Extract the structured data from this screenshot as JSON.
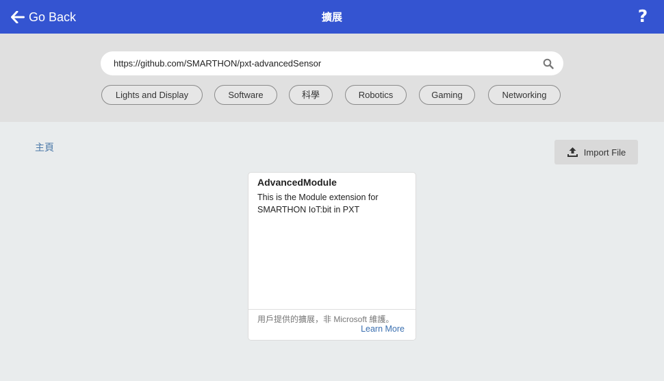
{
  "header": {
    "back_label": "Go Back",
    "title": "擴展",
    "help_label": "?"
  },
  "search": {
    "value": "https://github.com/SMARTHON/pxt-advancedSensor",
    "icon": "search-icon"
  },
  "categories": [
    "Lights and Display",
    "Software",
    "科學",
    "Robotics",
    "Gaming",
    "Networking"
  ],
  "breadcrumb": {
    "home": "主頁"
  },
  "import": {
    "label": "Import File",
    "icon": "upload-icon"
  },
  "results": [
    {
      "title": "AdvancedModule",
      "description": "This is the Module extension for SMARTHON IoT:bit in PXT",
      "note": "用戶提供的擴展，非 Microsoft 維護。",
      "learn_more": "Learn More"
    }
  ],
  "colors": {
    "header_bg": "#3454d1",
    "search_band_bg": "#e0e0e0",
    "page_bg": "#e9eced",
    "link": "#3a6fb0"
  }
}
